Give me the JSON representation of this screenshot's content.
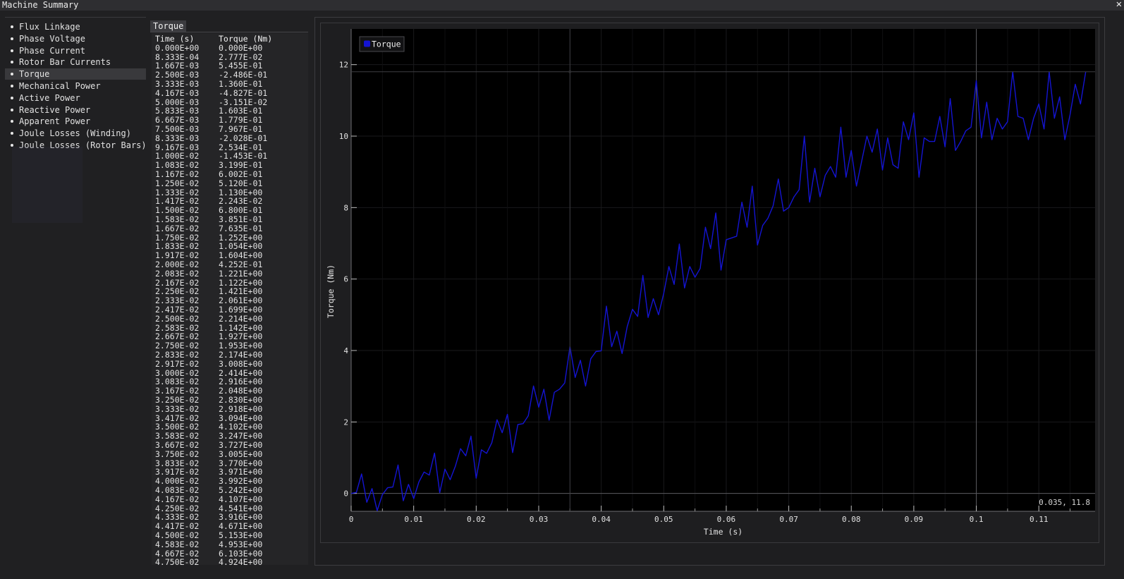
{
  "window": {
    "title": "Machine Summary",
    "close_glyph": "✕"
  },
  "sidebar": {
    "items": [
      {
        "label": "Flux Linkage",
        "selected": false
      },
      {
        "label": "Phase Voltage",
        "selected": false
      },
      {
        "label": "Phase Current",
        "selected": false
      },
      {
        "label": "Rotor Bar Currents",
        "selected": false
      },
      {
        "label": "Torque",
        "selected": true
      },
      {
        "label": "Mechanical Power",
        "selected": false
      },
      {
        "label": "Active Power",
        "selected": false
      },
      {
        "label": "Reactive Power",
        "selected": false
      },
      {
        "label": "Apparent Power",
        "selected": false
      },
      {
        "label": "Joule Losses (Winding)",
        "selected": false
      },
      {
        "label": "Joule Losses (Rotor Bars)",
        "selected": false
      }
    ]
  },
  "table": {
    "tab_label": "Torque",
    "columns": [
      "Time (s)",
      "Torque (Nm)"
    ],
    "rows": [
      [
        "0.000E+00",
        "0.000E+00"
      ],
      [
        "8.333E-04",
        "2.777E-02"
      ],
      [
        "1.667E-03",
        "5.455E-01"
      ],
      [
        "2.500E-03",
        "-2.486E-01"
      ],
      [
        "3.333E-03",
        "1.360E-01"
      ],
      [
        "4.167E-03",
        "-4.827E-01"
      ],
      [
        "5.000E-03",
        "-3.151E-02"
      ],
      [
        "5.833E-03",
        "1.603E-01"
      ],
      [
        "6.667E-03",
        "1.779E-01"
      ],
      [
        "7.500E-03",
        "7.967E-01"
      ],
      [
        "8.333E-03",
        "-2.028E-01"
      ],
      [
        "9.167E-03",
        "2.534E-01"
      ],
      [
        "1.000E-02",
        "-1.453E-01"
      ],
      [
        "1.083E-02",
        "3.199E-01"
      ],
      [
        "1.167E-02",
        "6.002E-01"
      ],
      [
        "1.250E-02",
        "5.120E-01"
      ],
      [
        "1.333E-02",
        "1.130E+00"
      ],
      [
        "1.417E-02",
        "2.243E-02"
      ],
      [
        "1.500E-02",
        "6.800E-01"
      ],
      [
        "1.583E-02",
        "3.851E-01"
      ],
      [
        "1.667E-02",
        "7.635E-01"
      ],
      [
        "1.750E-02",
        "1.252E+00"
      ],
      [
        "1.833E-02",
        "1.054E+00"
      ],
      [
        "1.917E-02",
        "1.604E+00"
      ],
      [
        "2.000E-02",
        "4.252E-01"
      ],
      [
        "2.083E-02",
        "1.221E+00"
      ],
      [
        "2.167E-02",
        "1.122E+00"
      ],
      [
        "2.250E-02",
        "1.421E+00"
      ],
      [
        "2.333E-02",
        "2.061E+00"
      ],
      [
        "2.417E-02",
        "1.699E+00"
      ],
      [
        "2.500E-02",
        "2.214E+00"
      ],
      [
        "2.583E-02",
        "1.142E+00"
      ],
      [
        "2.667E-02",
        "1.927E+00"
      ],
      [
        "2.750E-02",
        "1.953E+00"
      ],
      [
        "2.833E-02",
        "2.174E+00"
      ],
      [
        "2.917E-02",
        "3.008E+00"
      ],
      [
        "3.000E-02",
        "2.414E+00"
      ],
      [
        "3.083E-02",
        "2.916E+00"
      ],
      [
        "3.167E-02",
        "2.048E+00"
      ],
      [
        "3.250E-02",
        "2.830E+00"
      ],
      [
        "3.333E-02",
        "2.918E+00"
      ],
      [
        "3.417E-02",
        "3.094E+00"
      ],
      [
        "3.500E-02",
        "4.102E+00"
      ],
      [
        "3.583E-02",
        "3.247E+00"
      ],
      [
        "3.667E-02",
        "3.727E+00"
      ],
      [
        "3.750E-02",
        "3.005E+00"
      ],
      [
        "3.833E-02",
        "3.770E+00"
      ],
      [
        "3.917E-02",
        "3.971E+00"
      ],
      [
        "4.000E-02",
        "3.992E+00"
      ],
      [
        "4.083E-02",
        "5.242E+00"
      ],
      [
        "4.167E-02",
        "4.107E+00"
      ],
      [
        "4.250E-02",
        "4.541E+00"
      ],
      [
        "4.333E-02",
        "3.916E+00"
      ],
      [
        "4.417E-02",
        "4.671E+00"
      ],
      [
        "4.500E-02",
        "5.153E+00"
      ],
      [
        "4.583E-02",
        "4.953E+00"
      ],
      [
        "4.667E-02",
        "6.103E+00"
      ],
      [
        "4.750E-02",
        "4.924E+00"
      ]
    ]
  },
  "plot": {
    "legend_label": "Torque",
    "cursor_readout": "0.035, 11.8",
    "line_color": "#1414d2"
  },
  "chart_data": {
    "type": "line",
    "title": "",
    "xlabel": "Time (s)",
    "ylabel": "Torque (Nm)",
    "xlim": [
      0,
      0.119
    ],
    "ylim": [
      -0.5,
      13.0
    ],
    "x_ticks": [
      0,
      0.01,
      0.02,
      0.03,
      0.04,
      0.05,
      0.06,
      0.07,
      0.08,
      0.09,
      0.1,
      0.11
    ],
    "x_tick_labels": [
      "0",
      "0.01",
      "0.02",
      "0.03",
      "0.04",
      "0.05",
      "0.06",
      "0.07",
      "0.08",
      "0.09",
      "0.1",
      "0.11"
    ],
    "y_ticks": [
      0,
      2,
      4,
      6,
      8,
      10,
      12
    ],
    "y_tick_labels": [
      "0",
      "2",
      "4",
      "6",
      "8",
      "10",
      "12"
    ],
    "grid": true,
    "legend": "top-left",
    "x_step": 0.0008333,
    "series": [
      {
        "name": "Torque",
        "values": [
          0.0,
          0.028,
          0.546,
          -0.249,
          0.136,
          -0.483,
          -0.032,
          0.16,
          0.178,
          0.797,
          -0.203,
          0.253,
          -0.145,
          0.32,
          0.6,
          0.512,
          1.13,
          0.022,
          0.68,
          0.385,
          0.764,
          1.252,
          1.054,
          1.604,
          0.425,
          1.221,
          1.122,
          1.421,
          2.061,
          1.699,
          2.214,
          1.142,
          1.927,
          1.953,
          2.174,
          3.008,
          2.414,
          2.916,
          2.048,
          2.83,
          2.918,
          3.094,
          4.102,
          3.247,
          3.727,
          3.005,
          3.77,
          3.971,
          3.992,
          5.242,
          4.107,
          4.541,
          3.916,
          4.671,
          5.153,
          4.953,
          6.103,
          4.924,
          5.45,
          5.0,
          5.6,
          6.35,
          5.85,
          6.98,
          5.75,
          6.35,
          6.05,
          6.3,
          7.45,
          6.85,
          7.85,
          6.25,
          7.1,
          7.15,
          7.2,
          8.15,
          7.45,
          8.6,
          6.95,
          7.5,
          7.7,
          8.05,
          8.8,
          7.9,
          8.0,
          8.3,
          8.5,
          10.0,
          8.15,
          9.1,
          8.3,
          8.9,
          9.15,
          8.85,
          10.25,
          8.85,
          9.6,
          8.6,
          9.3,
          10.0,
          9.55,
          10.2,
          9.05,
          9.95,
          9.2,
          9.1,
          10.4,
          9.9,
          10.65,
          8.85,
          9.95,
          9.85,
          9.85,
          10.55,
          9.7,
          11.05,
          9.6,
          9.85,
          10.15,
          10.25,
          11.55,
          9.95,
          10.95,
          9.9,
          10.5,
          10.2,
          10.4,
          11.8,
          10.55,
          10.5,
          9.9,
          10.5,
          10.9,
          10.2,
          11.8,
          10.5,
          11.1,
          9.9,
          10.6,
          11.45,
          10.9,
          11.8
        ]
      }
    ]
  }
}
